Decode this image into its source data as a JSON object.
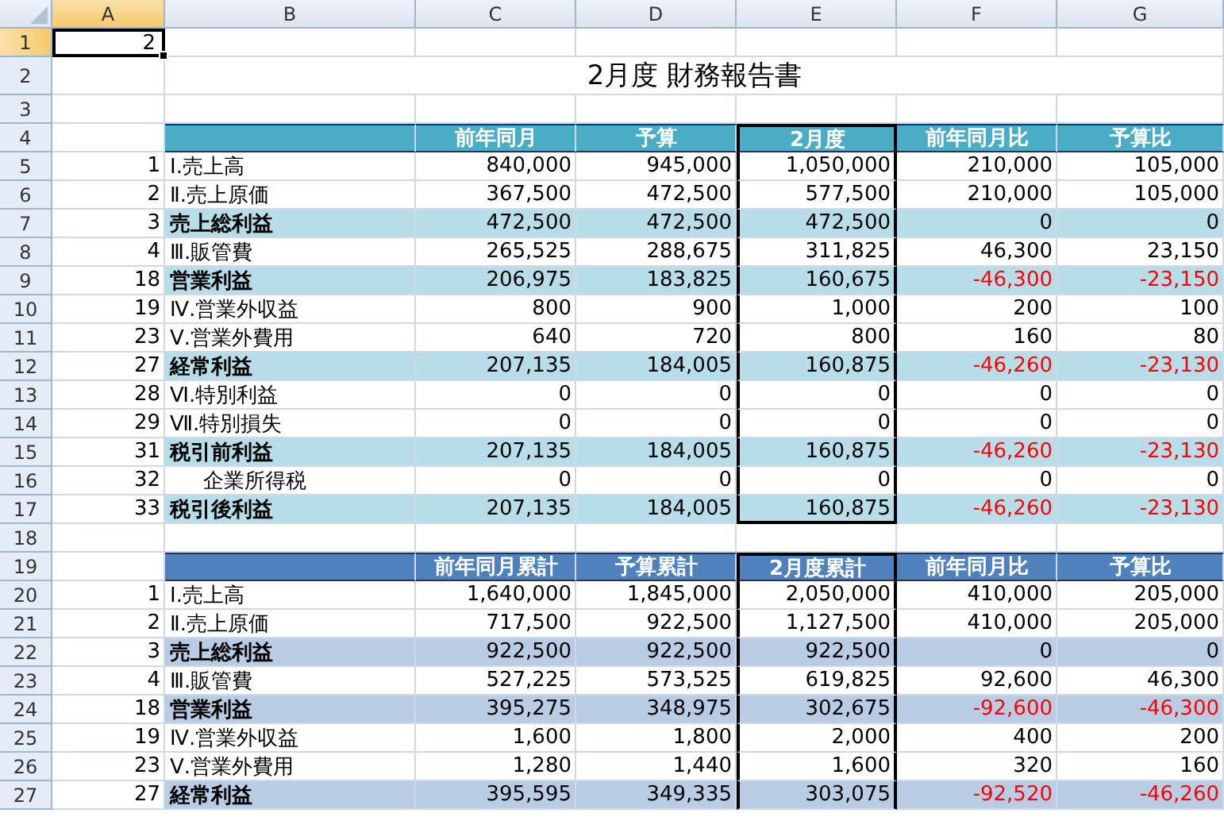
{
  "sheet": {
    "columns": [
      {
        "label": "A",
        "selected": true,
        "framed": false
      },
      {
        "label": "B",
        "selected": false,
        "framed": false
      },
      {
        "label": "C",
        "selected": false,
        "framed": false
      },
      {
        "label": "D",
        "selected": false,
        "framed": false
      },
      {
        "label": "E",
        "selected": false,
        "framed": true
      },
      {
        "label": "F",
        "selected": false,
        "framed": false
      },
      {
        "label": "G",
        "selected": false,
        "framed": false
      }
    ],
    "rows": [
      {
        "number": "1",
        "selected": true,
        "kind": "input",
        "value": "2"
      },
      {
        "number": "2",
        "selected": false,
        "kind": "title",
        "title": "2月度 財務報告書"
      },
      {
        "number": "3",
        "selected": false,
        "kind": "blank"
      },
      {
        "number": "4",
        "selected": false,
        "kind": "table_header",
        "color": "#4bacc6",
        "labels": [
          "前年同月",
          "予算",
          "2月度",
          "前年同月比",
          "予算比"
        ]
      },
      {
        "number": "5",
        "selected": false,
        "kind": "item",
        "index": "1",
        "label": "Ⅰ.売上高",
        "values": [
          "840,000",
          "945,000",
          "1,050,000",
          "210,000",
          "105,000"
        ],
        "variance_negative": false
      },
      {
        "number": "6",
        "selected": false,
        "kind": "item",
        "index": "2",
        "label": "Ⅱ.売上原価",
        "values": [
          "367,500",
          "472,500",
          "577,500",
          "210,000",
          "105,000"
        ],
        "variance_negative": false
      },
      {
        "number": "7",
        "selected": false,
        "kind": "total",
        "color": "#b7dde8",
        "index": "3",
        "label": "売上総利益",
        "values": [
          "472,500",
          "472,500",
          "472,500",
          "0",
          "0"
        ],
        "variance_negative": false
      },
      {
        "number": "8",
        "selected": false,
        "kind": "item",
        "index": "4",
        "label": "Ⅲ.販管費",
        "values": [
          "265,525",
          "288,675",
          "311,825",
          "46,300",
          "23,150"
        ],
        "variance_negative": false
      },
      {
        "number": "9",
        "selected": false,
        "kind": "total",
        "color": "#b7dde8",
        "index": "18",
        "label": "営業利益",
        "values": [
          "206,975",
          "183,825",
          "160,675",
          "-46,300",
          "-23,150"
        ],
        "variance_negative": true
      },
      {
        "number": "10",
        "selected": false,
        "kind": "item",
        "index": "19",
        "label": "Ⅳ.営業外収益",
        "values": [
          "800",
          "900",
          "1,000",
          "200",
          "100"
        ],
        "variance_negative": false
      },
      {
        "number": "11",
        "selected": false,
        "kind": "item",
        "index": "23",
        "label": "Ⅴ.営業外費用",
        "values": [
          "640",
          "720",
          "800",
          "160",
          "80"
        ],
        "variance_negative": false
      },
      {
        "number": "12",
        "selected": false,
        "kind": "total",
        "color": "#b7dde8",
        "index": "27",
        "label": "経常利益",
        "values": [
          "207,135",
          "184,005",
          "160,875",
          "-46,260",
          "-23,130"
        ],
        "variance_negative": true
      },
      {
        "number": "13",
        "selected": false,
        "kind": "item",
        "index": "28",
        "label": "Ⅵ.特別利益",
        "values": [
          "0",
          "0",
          "0",
          "0",
          "0"
        ],
        "variance_negative": false
      },
      {
        "number": "14",
        "selected": false,
        "kind": "item",
        "index": "29",
        "label": "Ⅶ.特別損失",
        "values": [
          "0",
          "0",
          "0",
          "0",
          "0"
        ],
        "variance_negative": false
      },
      {
        "number": "15",
        "selected": false,
        "kind": "total",
        "color": "#b7dde8",
        "index": "31",
        "label": "税引前利益",
        "values": [
          "207,135",
          "184,005",
          "160,875",
          "-46,260",
          "-23,130"
        ],
        "variance_negative": true
      },
      {
        "number": "16",
        "selected": false,
        "kind": "sub_item",
        "index": "32",
        "label": "企業所得税",
        "values": [
          "0",
          "0",
          "0",
          "0",
          "0"
        ],
        "variance_negative": false
      },
      {
        "number": "17",
        "selected": false,
        "kind": "total",
        "color": "#b7dde8",
        "index": "33",
        "label": "税引後利益",
        "values": [
          "207,135",
          "184,005",
          "160,875",
          "-46,260",
          "-23,130"
        ],
        "variance_negative": true
      },
      {
        "number": "18",
        "selected": false,
        "kind": "blank"
      },
      {
        "number": "19",
        "selected": false,
        "kind": "table_header",
        "color": "#4f81bd",
        "labels": [
          "前年同月累計",
          "予算累計",
          "2月度累計",
          "前年同月比",
          "予算比"
        ]
      },
      {
        "number": "20",
        "selected": false,
        "kind": "item",
        "index": "1",
        "label": "Ⅰ.売上高",
        "values": [
          "1,640,000",
          "1,845,000",
          "2,050,000",
          "410,000",
          "205,000"
        ],
        "variance_negative": false
      },
      {
        "number": "21",
        "selected": false,
        "kind": "item",
        "index": "2",
        "label": "Ⅱ.売上原価",
        "values": [
          "717,500",
          "922,500",
          "1,127,500",
          "410,000",
          "205,000"
        ],
        "variance_negative": false
      },
      {
        "number": "22",
        "selected": false,
        "kind": "total",
        "color": "#b8cce4",
        "index": "3",
        "label": "売上総利益",
        "values": [
          "922,500",
          "922,500",
          "922,500",
          "0",
          "0"
        ],
        "variance_negative": false
      },
      {
        "number": "23",
        "selected": false,
        "kind": "item",
        "index": "4",
        "label": "Ⅲ.販管費",
        "values": [
          "527,225",
          "573,525",
          "619,825",
          "92,600",
          "46,300"
        ],
        "variance_negative": false
      },
      {
        "number": "24",
        "selected": false,
        "kind": "total",
        "color": "#b8cce4",
        "index": "18",
        "label": "営業利益",
        "values": [
          "395,275",
          "348,975",
          "302,675",
          "-92,600",
          "-46,300"
        ],
        "variance_negative": true
      },
      {
        "number": "25",
        "selected": false,
        "kind": "item",
        "index": "19",
        "label": "Ⅳ.営業外収益",
        "values": [
          "1,600",
          "1,800",
          "2,000",
          "400",
          "200"
        ],
        "variance_negative": false
      },
      {
        "number": "26",
        "selected": false,
        "kind": "item",
        "index": "23",
        "label": "Ⅴ.営業外費用",
        "values": [
          "1,280",
          "1,440",
          "1,600",
          "320",
          "160"
        ],
        "variance_negative": false
      },
      {
        "number": "27",
        "selected": false,
        "kind": "total",
        "color": "#b8cce4",
        "index": "27",
        "label": "経常利益",
        "values": [
          "395,595",
          "349,335",
          "303,075",
          "-92,520",
          "-46,260"
        ],
        "variance_negative": true
      }
    ]
  }
}
